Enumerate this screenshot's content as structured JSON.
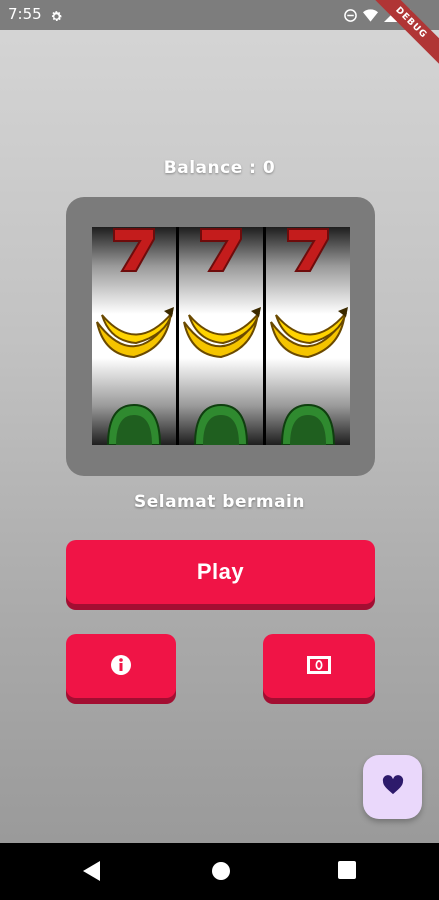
{
  "status_bar": {
    "time": "7:55",
    "icons": [
      "gear-icon",
      "do-not-disturb-icon",
      "wifi-icon",
      "cell-signal-icon",
      "battery-icon"
    ]
  },
  "debug_banner": "DEBUG",
  "game": {
    "balance_text": "Balance : 0",
    "message": "Selamat bermain",
    "reels": [
      {
        "top": "seven",
        "center": "banana",
        "bottom": "watermelon"
      },
      {
        "top": "seven",
        "center": "banana",
        "bottom": "watermelon"
      },
      {
        "top": "seven",
        "center": "banana",
        "bottom": "watermelon"
      }
    ]
  },
  "buttons": {
    "play_label": "Play",
    "info_icon": "info-icon",
    "money_icon": "money-icon",
    "fab_icon": "heart-icon"
  },
  "nav_bar": {
    "icons": [
      "back-icon",
      "home-icon",
      "recents-icon"
    ]
  },
  "colors": {
    "accent": "#f01446",
    "accent_shadow": "#a30e32",
    "fab_bg": "#ead8fb",
    "fab_icon": "#2d1a6b",
    "machine_frame": "#7b7b7b"
  }
}
